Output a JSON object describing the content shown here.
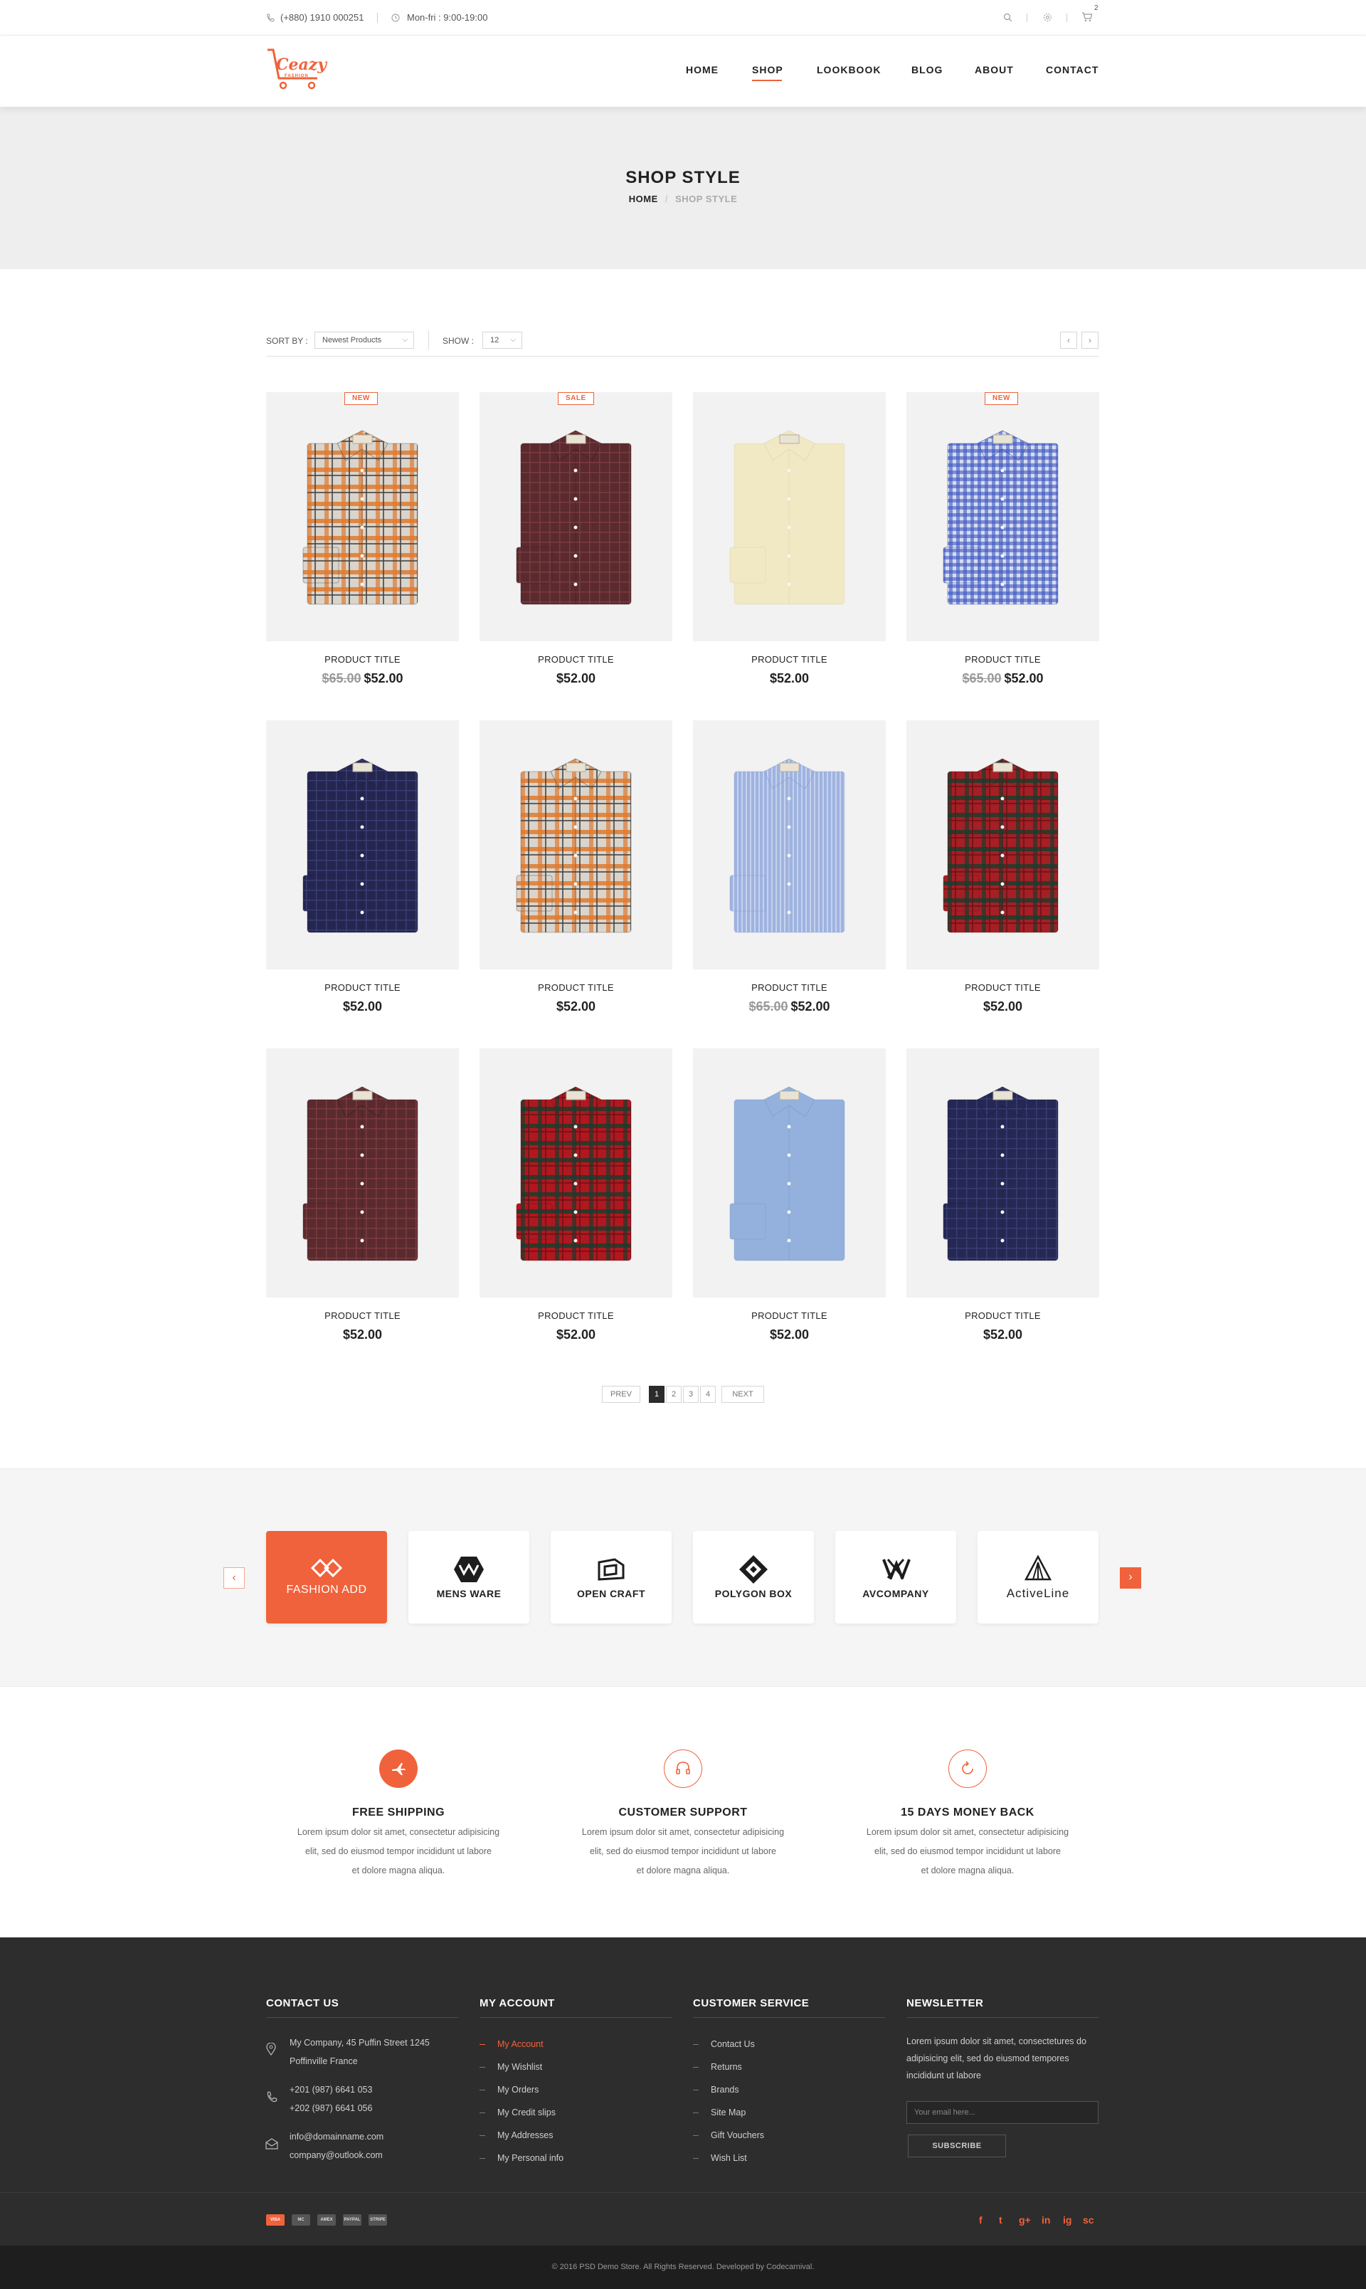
{
  "topbar": {
    "phone": "(+880) 1910 000251",
    "hours": "Mon-fri : 9:00-19:00",
    "cart_count": "2"
  },
  "header": {
    "logo_text": "Ceazy",
    "logo_sub": "FASHION",
    "nav": [
      "HOME",
      "SHOP",
      "LOOKBOOK",
      "BLOG",
      "ABOUT",
      "CONTACT"
    ],
    "active_nav": "SHOP"
  },
  "page_title": {
    "title": "SHOP STYLE",
    "breadcrumb_home": "HOME",
    "breadcrumb_sep": "/",
    "breadcrumb_current": "SHOP STYLE"
  },
  "toolbar": {
    "sort_label": "SORT BY :",
    "sort_value": "Newest Products",
    "show_label": "SHOW :",
    "show_value": "12",
    "prev_arrow": "‹",
    "next_arrow": "›"
  },
  "products": [
    {
      "title": "PRODUCT TITLE",
      "old_price": "$65.00",
      "price": "$52.00",
      "badge": "NEW",
      "shirt": {
        "base": "#d9d4cc",
        "stripe": "#e07a2f",
        "dark": "#4a4440",
        "pattern": "plaid"
      }
    },
    {
      "title": "PRODUCT TITLE",
      "old_price": "",
      "price": "$52.00",
      "badge": "SALE",
      "shirt": {
        "base": "#5a2a2e",
        "stripe": "#7a3c40",
        "dark": "#2f1e22",
        "pattern": "check"
      }
    },
    {
      "title": "PRODUCT TITLE",
      "old_price": "",
      "price": "$52.00",
      "badge": "",
      "shirt": {
        "base": "#f1e8c4",
        "stripe": "#f1e8c4",
        "dark": "#d8cfa8",
        "pattern": "solid"
      }
    },
    {
      "title": "PRODUCT TITLE",
      "old_price": "$65.00",
      "price": "$52.00",
      "badge": "NEW",
      "shirt": {
        "base": "#3d58c2",
        "stripe": "#d7dcf0",
        "dark": "#2b3f96",
        "pattern": "gingham"
      }
    },
    {
      "title": "PRODUCT TITLE",
      "old_price": "",
      "price": "$52.00",
      "badge": "",
      "shirt": {
        "base": "#24264f",
        "stripe": "#3a3d72",
        "dark": "#191a38",
        "pattern": "check"
      }
    },
    {
      "title": "PRODUCT TITLE",
      "old_price": "",
      "price": "$52.00",
      "badge": "",
      "shirt": {
        "base": "#d9d4cc",
        "stripe": "#e07a2f",
        "dark": "#4a4440",
        "pattern": "plaid"
      }
    },
    {
      "title": "PRODUCT TITLE",
      "old_price": "$65.00",
      "price": "$52.00",
      "badge": "",
      "shirt": {
        "base": "#9fb3e0",
        "stripe": "#c6d2ee",
        "dark": "#7f95c8",
        "pattern": "stripe"
      }
    },
    {
      "title": "PRODUCT TITLE",
      "old_price": "",
      "price": "$52.00",
      "badge": "",
      "shirt": {
        "base": "#a51f25",
        "stripe": "#1d3b2c",
        "dark": "#6b1217",
        "pattern": "tartan"
      }
    },
    {
      "title": "PRODUCT TITLE",
      "old_price": "",
      "price": "$52.00",
      "badge": "",
      "shirt": {
        "base": "#5a2a2e",
        "stripe": "#7a3c40",
        "dark": "#2f1e22",
        "pattern": "check"
      }
    },
    {
      "title": "PRODUCT TITLE",
      "old_price": "",
      "price": "$52.00",
      "badge": "",
      "shirt": {
        "base": "#b0181f",
        "stripe": "#1d3b2c",
        "dark": "#6b1217",
        "pattern": "tartan"
      }
    },
    {
      "title": "PRODUCT TITLE",
      "old_price": "",
      "price": "$52.00",
      "badge": "",
      "shirt": {
        "base": "#93b1dc",
        "stripe": "#93b1dc",
        "dark": "#7393c2",
        "pattern": "solid"
      }
    },
    {
      "title": "PRODUCT TITLE",
      "old_price": "",
      "price": "$52.00",
      "badge": "",
      "shirt": {
        "base": "#252852",
        "stripe": "#3a3d72",
        "dark": "#191a38",
        "pattern": "check"
      }
    }
  ],
  "pagination": {
    "prev": "PREV",
    "pages": [
      "1",
      "2",
      "3",
      "4"
    ],
    "current": "1",
    "next": "NEXT"
  },
  "brands": [
    {
      "name": "FASHION ADD",
      "icon": "diamond-logo-icon",
      "active": true
    },
    {
      "name": "MENS WARE",
      "icon": "mens-ware-logo-icon",
      "active": false
    },
    {
      "name": "OPEN CRAFT",
      "icon": "open-craft-logo-icon",
      "active": false
    },
    {
      "name": "POLYGON BOX",
      "icon": "polygon-box-logo-icon",
      "active": false
    },
    {
      "name": "AVCOMPANY",
      "icon": "avcompany-logo-icon",
      "active": false
    },
    {
      "name": "ActiveLine",
      "icon": "activeline-logo-icon",
      "active": false
    }
  ],
  "services": [
    {
      "title": "FREE SHIPPING",
      "text": [
        "Lorem ipsum dolor sit amet, consectetur adipisicing",
        "elit, sed do eiusmod tempor incididunt ut labore",
        "et dolore magna aliqua."
      ],
      "icon": "plane-icon"
    },
    {
      "title": "CUSTOMER SUPPORT",
      "text": [
        "Lorem ipsum dolor sit amet, consectetur adipisicing",
        "elit, sed do eiusmod tempor incididunt ut labore",
        "et dolore magna aliqua."
      ],
      "icon": "headset-icon"
    },
    {
      "title": "15 DAYS MONEY BACK",
      "text": [
        "Lorem ipsum dolor sit amet, consectetur adipisicing",
        "elit, sed do eiusmod tempor incididunt ut labore",
        "et dolore magna aliqua."
      ],
      "icon": "refresh-icon"
    }
  ],
  "footer": {
    "contact": {
      "heading": "CONTACT US",
      "address": [
        "My Company, 45 Puffin Street 1245",
        "Poffinville France"
      ],
      "phones": [
        "+201 (987) 6641 053",
        "+202 (987) 6641 056"
      ],
      "emails": [
        "info@domainname.com",
        "company@outlook.com"
      ]
    },
    "account": {
      "heading": "MY ACCOUNT",
      "links": [
        "My Account",
        "My Wishlist",
        "My Orders",
        "My Credit slips",
        "My Addresses",
        "My Personal info"
      ]
    },
    "service": {
      "heading": "CUSTOMER SERVICE",
      "links": [
        "Contact Us",
        "Returns",
        "Brands",
        "Site Map",
        "Gift Vouchers",
        "Wish List"
      ]
    },
    "newsletter": {
      "heading": "NEWSLETTER",
      "text": [
        "Lorem ipsum dolor sit amet, consectetures do",
        "adipisicing elit, sed do eiusmod tempores",
        "incididunt ut labore"
      ],
      "placeholder": "Your email here...",
      "button": "SUBSCRIBE"
    },
    "payments": [
      "VISA",
      "MC",
      "AMEX",
      "PAYPAL",
      "STRIPE"
    ],
    "social": [
      "f",
      "t",
      "g+",
      "in",
      "ig",
      "sc"
    ],
    "copyright": "© 2016 PSD Demo Store. All Rights Reserved. Developed by Codecarnival."
  },
  "colors": {
    "accent": "#f0623b",
    "dark": "#2d2d2d",
    "light_bg": "#f2f2f2"
  }
}
